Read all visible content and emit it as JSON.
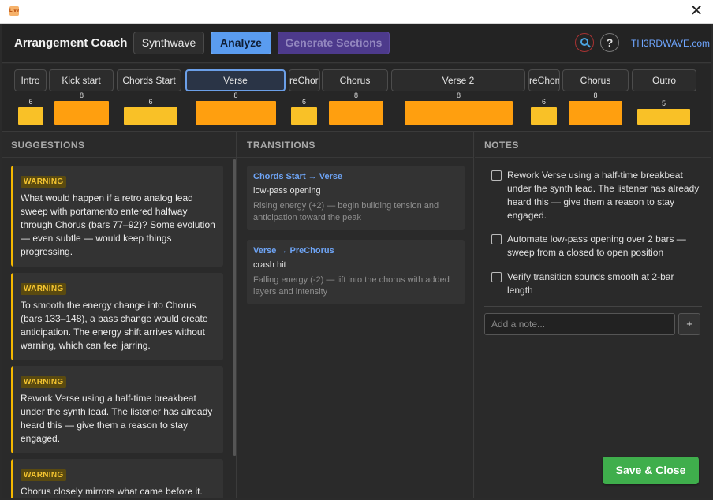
{
  "window": {
    "close_glyph": "✕",
    "icon_text": "Live"
  },
  "header": {
    "title": "Arrangement Coach",
    "synth_label": "Synthwave",
    "analyze_label": "Analyze",
    "generate_label": "Generate Sections",
    "help_glyph": "?",
    "site_link": "TH3RDWAVE.com"
  },
  "sections": [
    {
      "name": "Intro",
      "bars": "6",
      "energy": 0.55,
      "color": "#f9c127"
    },
    {
      "name": "Kick start",
      "bars": "8",
      "energy": 0.75,
      "color": "#ff9f0f"
    },
    {
      "name": "Chords Start",
      "bars": "6",
      "energy": 0.55,
      "color": "#f9c127"
    },
    {
      "name": "Verse",
      "bars": "8",
      "energy": 0.75,
      "color": "#ff9f0f",
      "selected": true
    },
    {
      "name": "reChoru",
      "bars": "6",
      "energy": 0.55,
      "color": "#f9c127"
    },
    {
      "name": "Chorus",
      "bars": "8",
      "energy": 0.75,
      "color": "#ff9f0f"
    },
    {
      "name": "Verse 2",
      "bars": "8",
      "energy": 0.75,
      "color": "#ff9f0f"
    },
    {
      "name": "reChon",
      "bars": "6",
      "energy": 0.55,
      "color": "#f9c127"
    },
    {
      "name": "Chorus",
      "bars": "8",
      "energy": 0.75,
      "color": "#ff9f0f"
    },
    {
      "name": "Outro",
      "bars": "5",
      "energy": 0.5,
      "color": "#f9c127"
    }
  ],
  "suggestions": {
    "heading": "SUGGESTIONS",
    "items": [
      {
        "badge": "WARNING",
        "text": "What would happen if a retro analog lead sweep with portamento entered halfway through Chorus (bars 77–92)? Some evolution — even subtle — would keep things progressing."
      },
      {
        "badge": "WARNING",
        "text": "To smooth the energy change into Chorus (bars 133–148), a bass change would create anticipation. The energy shift arrives without warning, which can feel jarring."
      },
      {
        "badge": "WARNING",
        "text": "Rework Verse using a half-time breakbeat under the synth lead. The listener has already heard this — give them a reason to stay engaged."
      },
      {
        "badge": "WARNING",
        "text": "Chorus closely mirrors what came before it."
      }
    ]
  },
  "transitions": {
    "heading": "TRANSITIONS",
    "items": [
      {
        "title": "Chords Start → Verse",
        "effect": "low-pass opening",
        "desc": "Rising energy (+2) — begin building tension and anticipation toward the peak"
      },
      {
        "title": "Verse → PreChorus",
        "effect": "crash hit",
        "desc": "Falling energy (-2) — lift into the chorus with added layers and intensity"
      }
    ]
  },
  "notes": {
    "heading": "NOTES",
    "items": [
      {
        "text": "Rework Verse using a half-time breakbeat under the synth lead. The listener has already heard this — give them a reason to stay engaged."
      },
      {
        "text": "Automate low-pass opening over 2 bars — sweep from a closed to open position"
      },
      {
        "text": "Verify transition sounds smooth at 2-bar length"
      }
    ],
    "input_placeholder": "Add a note...",
    "add_label": "+",
    "save_label": "Save & Close"
  }
}
